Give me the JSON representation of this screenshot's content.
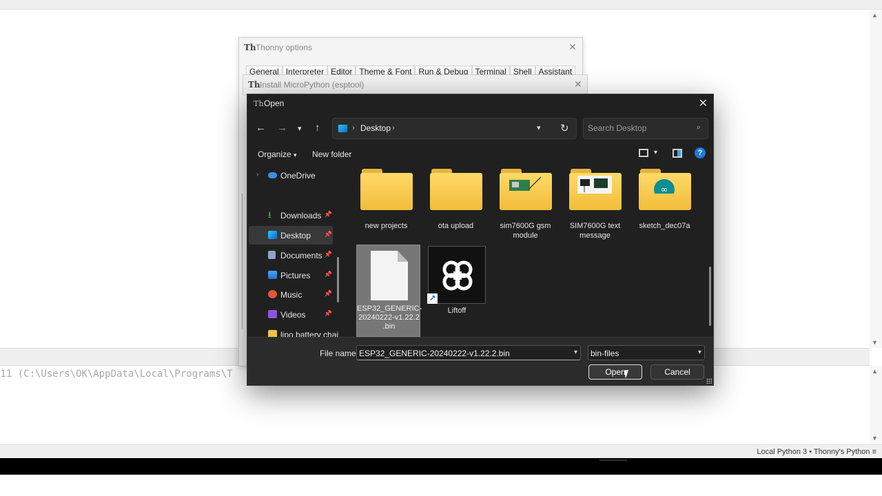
{
  "shell": {
    "text": ".11 (C:\\Users\\OK\\AppData\\Local\\Programs\\T"
  },
  "status": {
    "interpreter": "Local Python 3",
    "separator": "•",
    "python": "Thonny's Python",
    "menu_glyph": "≡"
  },
  "options_dialog": {
    "title": "Thonny options",
    "tabs": [
      "General",
      "Interpreter",
      "Editor",
      "Theme & Font",
      "Run & Debug",
      "Terminal",
      "Shell",
      "Assistant"
    ],
    "active_tab": "Interpreter"
  },
  "install_dialog": {
    "title": "Install MicroPython (esptool)"
  },
  "open_dialog": {
    "title": "Open",
    "address": {
      "location": "Desktop"
    },
    "search_placeholder": "Search Desktop",
    "commands": {
      "organize": "Organize",
      "new_folder": "New folder",
      "help": "?"
    },
    "nav_items": [
      {
        "label": "OneDrive",
        "icon": "cloud-icon",
        "pinned": false
      },
      {
        "label": "Downloads",
        "icon": "download-icon",
        "pinned": true
      },
      {
        "label": "Desktop",
        "icon": "desktop-icon",
        "pinned": true,
        "selected": true
      },
      {
        "label": "Documents",
        "icon": "documents-icon",
        "pinned": true
      },
      {
        "label": "Pictures",
        "icon": "pictures-icon",
        "pinned": true
      },
      {
        "label": "Music",
        "icon": "music-icon",
        "pinned": true
      },
      {
        "label": "Videos",
        "icon": "videos-icon",
        "pinned": true
      },
      {
        "label": "lipo battery chai",
        "icon": "folder-icon",
        "pinned": false
      }
    ],
    "folders": [
      {
        "name": "new projects"
      },
      {
        "name": "ota upload"
      },
      {
        "name": "sim7600G gsm module"
      },
      {
        "name": "SIM7600G text message"
      },
      {
        "name": "sketch_dec07a"
      }
    ],
    "files": [
      {
        "name": "ESP32_GENERIC-20240222-v1.22.2.bin",
        "display_lines": [
          "ESP32_GENERIC-",
          "20240222-v1.22.2",
          ".bin"
        ],
        "selected": true
      },
      {
        "name": "Liftoff",
        "shortcut": true
      }
    ],
    "file_name_label": "File name:",
    "file_name_value": "ESP32_GENERIC-20240222-v1.22.2.bin",
    "file_type": "bin-files",
    "open_label": "Open",
    "cancel_label": "Cancel"
  }
}
